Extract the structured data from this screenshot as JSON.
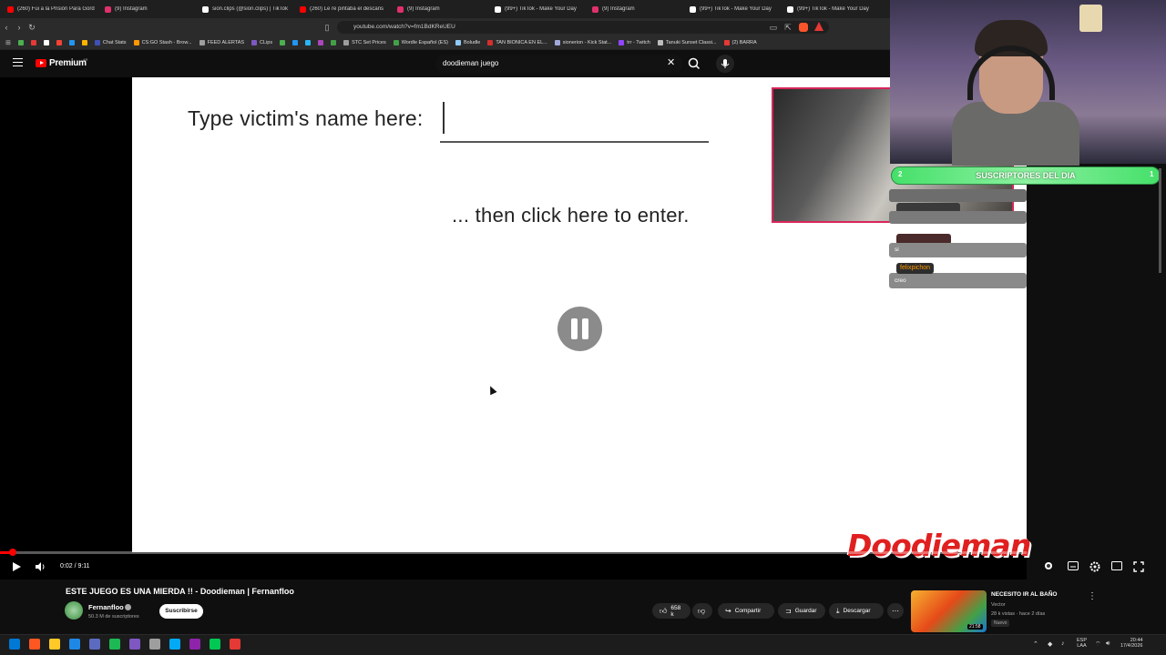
{
  "browser": {
    "tabs": [
      {
        "title": "(260) Fui a la Prisión Para Gord",
        "color": "#ff0000"
      },
      {
        "title": "(9) Instagram",
        "color": "#e1306c"
      },
      {
        "title": "sion.clips (@sion.clips) | TikTok",
        "color": "#ffffff"
      },
      {
        "title": "(260) Le re pintaba el descans",
        "color": "#ff0000"
      },
      {
        "title": "(9) Instagram",
        "color": "#e1306c"
      },
      {
        "title": "(99+) TikTok - Make Your Day",
        "color": "#ffffff"
      },
      {
        "title": "(9) Instagram",
        "color": "#e1306c"
      },
      {
        "title": "(99+) TikTok - Make Your Day",
        "color": "#ffffff"
      },
      {
        "title": "(99+) TikTok - Make Your Day",
        "color": "#ffffff"
      }
    ],
    "url": "youtube.com/watch?v=fm1BdKReUEU",
    "bookmarks": [
      {
        "label": "",
        "color": "#4caf50"
      },
      {
        "label": "",
        "color": "#e53935"
      },
      {
        "label": "",
        "color": "#ffffff"
      },
      {
        "label": "",
        "color": "#f44336"
      },
      {
        "label": "",
        "color": "#2196f3"
      },
      {
        "label": "",
        "color": "#ffb300"
      },
      {
        "label": "Chat Stats",
        "color": "#3f51b5"
      },
      {
        "label": "CS:GO Stash - Brow...",
        "color": "#ff9800"
      },
      {
        "label": "FEED ALERTAS",
        "color": "#9e9e9e"
      },
      {
        "label": "CLips",
        "color": "#7e57c2"
      },
      {
        "label": "",
        "color": "#4caf50"
      },
      {
        "label": "",
        "color": "#2196f3"
      },
      {
        "label": "",
        "color": "#29b6f6"
      },
      {
        "label": "",
        "color": "#ab47bc"
      },
      {
        "label": "",
        "color": "#43a047"
      },
      {
        "label": "STC Set Prices",
        "color": "#9e9e9e"
      },
      {
        "label": "Wordle Español (ES)",
        "color": "#43a047"
      },
      {
        "label": "Boludle",
        "color": "#90caf9"
      },
      {
        "label": "TAN BIONICA EN EL...",
        "color": "#d32f2f"
      },
      {
        "label": "sionerion - Kick Stat...",
        "color": "#9fa8da"
      },
      {
        "label": "trr - Twitch",
        "color": "#9146ff"
      },
      {
        "label": "Tanuki Sunset Classi...",
        "color": "#bdbdbd"
      },
      {
        "label": "(2) BARRA",
        "color": "#e53935"
      }
    ]
  },
  "youtube": {
    "brand": "Premium",
    "region": "AR",
    "search_value": "doodieman juego",
    "search_clear_icon": "✕"
  },
  "game": {
    "prompt": "Type victim's name here:",
    "enter_text": "... then click here to enter.",
    "watermark": "Doodieman"
  },
  "player": {
    "time": "0:02 / 9:11",
    "progress_fraction": 0.004
  },
  "overlay": {
    "subs_banner": "SUSCRIPTORES DEL DIA",
    "subs_left": "2",
    "subs_right": "1",
    "chat": [
      {
        "name": "felixpichon",
        "name_color": "#ff9800",
        "message": "creo"
      }
    ],
    "chat_extra_message": "si"
  },
  "video": {
    "title": "ESTE JUEGO ES UNA MIERDA !! - Doodieman | Fernanfloo",
    "channel": "Fernanfloo",
    "subscribers": "50.3 M de suscriptores",
    "subscribe_label": "Suscribirse",
    "likes": "658 k",
    "share_label": "Compartir",
    "save_label": "Guardar",
    "download_label": "Descargar"
  },
  "recommendation": {
    "title": "NECESITO IR AL BAÑO",
    "channel": "Vector",
    "meta": "28 k vistas · hace 2 días",
    "badge": "Nuevo",
    "duration": "21:58"
  },
  "taskbar": {
    "lang_line1": "ESP",
    "lang_line2": "LAA",
    "time": "20:44",
    "date": "17/4/2026",
    "apps": [
      "#0078d4",
      "#ff5722",
      "#ffca28",
      "#1e88e5",
      "#5c6bc0",
      "#1db954",
      "#7e57c2",
      "#9e9e9e",
      "#03a9f4",
      "#8e24aa",
      "#00c853",
      "#e53935"
    ]
  }
}
